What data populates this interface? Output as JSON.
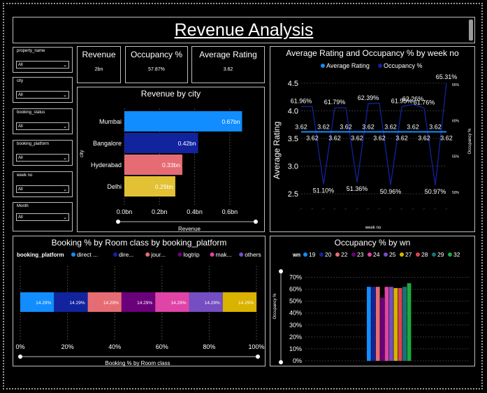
{
  "page_title": "Revenue Analysis",
  "slicers": [
    {
      "label": "property_name",
      "value": "All"
    },
    {
      "label": "city",
      "value": "All"
    },
    {
      "label": "booking_status",
      "value": "All"
    },
    {
      "label": "booking_platform",
      "value": "All"
    },
    {
      "label": "week no",
      "value": "All"
    },
    {
      "label": "Month",
      "value": "All"
    }
  ],
  "kpis": {
    "revenue": {
      "label": "Revenue",
      "value": "2bn"
    },
    "occupancy": {
      "label": "Occupancy %",
      "value": "57.87%"
    },
    "rating": {
      "label": "Average Rating",
      "value": "3.62"
    }
  },
  "revenue_by_city": {
    "title": "Revenue by city",
    "ylabel": "city",
    "xlabel": "Revenue",
    "ticks": [
      "0.0bn",
      "0.2bn",
      "0.4bn",
      "0.6bn"
    ],
    "colors": {
      "Mumbai": "#118DFF",
      "Bangalore": "#12239E",
      "Hyderabad": "#E66C74",
      "Delhi": "#E2C135"
    }
  },
  "combo": {
    "title": "Average Rating and Occupancy % by week no",
    "legend": [
      "Average Rating",
      "Occupancy %"
    ],
    "ylabel_left": "Average Rating",
    "ylabel_right": "Occupancy %",
    "xlabel": "week no",
    "left_ticks": [
      "4.5",
      "4.0",
      "3.5",
      "3.0",
      "2.5"
    ],
    "right_ticks": [
      "65%",
      "60%",
      "55%",
      "50%"
    ],
    "rating_labels": [
      "3.62",
      "3.62",
      "3.62",
      "3.62",
      "3.62",
      "3.62",
      "3.62",
      "3.62",
      "3.62",
      "3.62",
      "3.62",
      "3.62",
      "3.62",
      "3.62"
    ],
    "occ_labels": [
      "61.96%",
      "51.10%",
      "61.79%",
      "51.36%",
      "62.39%",
      "50.96%",
      "61.95%",
      "62.26%",
      "61.76%",
      "50.97%",
      "65.31%"
    ]
  },
  "booking": {
    "title": "Booking % by Room class by booking_platform",
    "legend_title": "booking_platform",
    "legend": [
      "direct ...",
      "dire...",
      "jour...",
      "logtrip",
      "mak...",
      "others",
      "tripster"
    ],
    "ticks": [
      "0%",
      "20%",
      "40%",
      "60%",
      "80%",
      "100%"
    ],
    "xlabel": "Booking % by Room class"
  },
  "occ_wn": {
    "title": "Occupancy % by wn",
    "legend_title": "wn",
    "legend": [
      "19",
      "20",
      "22",
      "23",
      "24",
      "25",
      "27",
      "28",
      "29",
      "32"
    ],
    "ticks": [
      "70%",
      "60%",
      "50%",
      "40%",
      "30%",
      "20%",
      "10%",
      "0%"
    ],
    "ylabel": "Occupancy %"
  },
  "chart_data": [
    {
      "type": "bar",
      "title": "Revenue by city",
      "categories": [
        "Mumbai",
        "Bangalore",
        "Hyderabad",
        "Delhi"
      ],
      "values": [
        0.67,
        0.42,
        0.33,
        0.29
      ],
      "data_labels": [
        "0.67bn",
        "0.42bn",
        "0.33bn",
        "0.29bn"
      ],
      "xlabel": "Revenue",
      "ylabel": "city",
      "xlim": [
        0,
        0.7
      ],
      "orientation": "horizontal"
    },
    {
      "type": "line",
      "title": "Average Rating and Occupancy % by week no",
      "series": [
        {
          "name": "Average Rating",
          "values": [
            3.62,
            3.62,
            3.62,
            3.62,
            3.62,
            3.62,
            3.62,
            3.62,
            3.62,
            3.62,
            3.62,
            3.62,
            3.62,
            3.62
          ]
        },
        {
          "name": "Occupancy %",
          "values": [
            61.96,
            61.96,
            51.1,
            61.79,
            61.79,
            51.36,
            62.39,
            62.39,
            50.96,
            61.95,
            62.26,
            61.76,
            50.97,
            65.31
          ]
        }
      ],
      "ylabel": "Average Rating",
      "xlabel": "week no",
      "ylim": [
        2.4,
        4.6
      ],
      "y2lim": [
        49,
        66
      ]
    },
    {
      "type": "bar",
      "title": "Booking % by Room class by booking_platform",
      "stacked": true,
      "series": [
        {
          "name": "direct ...",
          "values": [
            14.29
          ]
        },
        {
          "name": "dire...",
          "values": [
            14.29
          ]
        },
        {
          "name": "jour...",
          "values": [
            14.29
          ]
        },
        {
          "name": "logtrip",
          "values": [
            14.29
          ]
        },
        {
          "name": "mak...",
          "values": [
            14.29
          ]
        },
        {
          "name": "others",
          "values": [
            14.29
          ]
        },
        {
          "name": "tripster",
          "values": [
            14.29
          ]
        }
      ],
      "data_labels": [
        "14.29%",
        "14.29%",
        "14.29%",
        "14.29%",
        "14.29%",
        "14.29%",
        "14.29%"
      ],
      "xlabel": "Booking % by Room class",
      "xlim": [
        0,
        100
      ]
    },
    {
      "type": "bar",
      "title": "Occupancy % by wn",
      "categories": [
        "19",
        "20",
        "22",
        "23",
        "24",
        "25",
        "27",
        "28",
        "29",
        "32"
      ],
      "values": [
        62,
        62,
        62,
        53,
        62,
        62,
        61,
        61,
        62,
        65
      ],
      "ylabel": "Occupancy %",
      "ylim": [
        0,
        75
      ]
    }
  ],
  "colors": {
    "series": [
      "#118DFF",
      "#12239E",
      "#E66C74",
      "#6B007B",
      "#E044A7",
      "#744EC2",
      "#D9B300",
      "#D64550",
      "#197278",
      "#1AAB40"
    ],
    "booking": [
      "#118DFF",
      "#12239E",
      "#E66C74",
      "#6B007B",
      "#E044A7",
      "#744EC2",
      "#D9B300"
    ],
    "combo_rating": "#118DFF",
    "combo_occ": "#12239E"
  }
}
